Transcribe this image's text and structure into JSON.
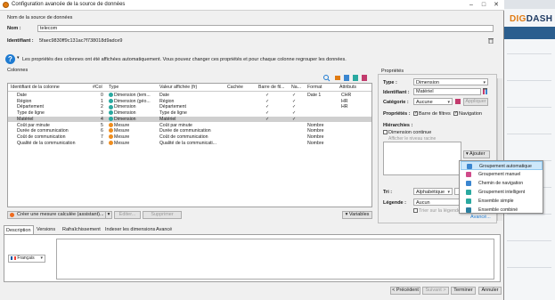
{
  "window": {
    "title": "Configuration avancée de la source de données"
  },
  "source": {
    "section_label": "Nom de la source de données",
    "name_label": "Nom :",
    "name_value": "telecom",
    "id_label": "Identifiant :",
    "id_value": "5faec9830ff9c131ac7f738018d9adce9"
  },
  "info_text": "Les propriétés des colonnes ont été affichées automatiquement. Vous pouvez changer ces propriétés et pour chaque colonne regrouper les données.",
  "columns_title": "Colonnes",
  "table": {
    "headers": [
      "Identifiant de la colonne",
      "#Col",
      "Type",
      "Valeur affichée (fr)",
      "Cachée",
      "Barre de fil...",
      "Na...",
      "Format",
      "Attributs"
    ],
    "rows": [
      {
        "id": "Date",
        "col": "0",
        "type": "Dimension (tem...",
        "kind": "dim",
        "value": "Date",
        "filter": "✓",
        "nav": "✓",
        "format": "Date 1",
        "attr": "CHR"
      },
      {
        "id": "Région",
        "col": "1",
        "type": "Dimension (géo...",
        "kind": "dim",
        "value": "Région",
        "filter": "✓",
        "nav": "✓",
        "format": "",
        "attr": "HR"
      },
      {
        "id": "Département",
        "col": "2",
        "type": "Dimension",
        "kind": "dim",
        "value": "Département",
        "filter": "✓",
        "nav": "✓",
        "format": "",
        "attr": "HR"
      },
      {
        "id": "Type de ligne",
        "col": "3",
        "type": "Dimension",
        "kind": "dim",
        "value": "Type de ligne",
        "filter": "✓",
        "nav": "✓",
        "format": "",
        "attr": ""
      },
      {
        "id": "Matériel",
        "col": "4",
        "type": "Dimension",
        "kind": "dim",
        "value": "Matériel",
        "filter": "✓",
        "nav": "✓",
        "format": "",
        "attr": ""
      },
      {
        "id": "Coût par minute",
        "col": "5",
        "type": "Mesure",
        "kind": "mes",
        "value": "Coût par minute",
        "filter": "",
        "nav": "",
        "format": "Nombre",
        "attr": ""
      },
      {
        "id": "Durée de communication",
        "col": "6",
        "type": "Mesure",
        "kind": "mes",
        "value": "Durée de communication",
        "filter": "",
        "nav": "",
        "format": "Nombre",
        "attr": ""
      },
      {
        "id": "Coût de communication",
        "col": "7",
        "type": "Mesure",
        "kind": "mes",
        "value": "Coût de communication",
        "filter": "",
        "nav": "",
        "format": "Nombre",
        "attr": ""
      },
      {
        "id": "Qualité de la communication",
        "col": "8",
        "type": "Mesure",
        "kind": "mes",
        "value": "Qualité de la communicati...",
        "filter": "",
        "nav": "",
        "format": "Nombre",
        "attr": ""
      }
    ],
    "selected_index": 4
  },
  "table_buttons": {
    "create_measure": "Créer une mesure calculée (assistant)...",
    "edit": "Éditer...",
    "delete": "Supprimer",
    "variables": "Variables"
  },
  "props": {
    "title": "Propriétés",
    "type_label": "Type :",
    "type_value": "Dimension",
    "id_label": "Identifiant :",
    "id_value": "Matériel",
    "category_label": "Catégorie :",
    "category_value": "Aucune",
    "apply": "Appliquer",
    "properties_label": "Propriétés :",
    "filter_bar": "Barre de filtres",
    "navigation": "Navigation",
    "hierarchies_label": "Hiérarchies :",
    "continuous": "Dimension continue",
    "show_level": "Afficher le niveau racine",
    "add_button": "Ajouter",
    "sort_label": "Tri :",
    "sort_value": "Alphabétique",
    "legend_label": "Légende :",
    "legend_value": "Aucun",
    "legend_sort": "Trier sur la légende",
    "advanced": "Avancé..."
  },
  "menu": [
    {
      "label": "Groupement automatique",
      "icon": "auto-group-icon",
      "color": "#3a86d0"
    },
    {
      "label": "Groupement manuel",
      "icon": "manual-group-icon",
      "color": "#d04a8a"
    },
    {
      "label": "Chemin de navigation",
      "icon": "nav-path-icon",
      "color": "#3a86d0"
    },
    {
      "label": "Groupement intelligent",
      "icon": "smart-group-icon",
      "color": "#2aa9a0"
    },
    {
      "label": "Ensemble simple",
      "icon": "simple-set-icon",
      "color": "#2aa9a0"
    },
    {
      "label": "Ensemble combiné",
      "icon": "combined-set-icon",
      "color": "#2a7fa0"
    }
  ],
  "tabs": [
    "Description",
    "Versions",
    "Rafraîchissement",
    "Indexer les dimensions",
    "Avancé"
  ],
  "language": "Français",
  "footer": {
    "prev": "< Précédent",
    "next": "Suivant >",
    "finish": "Terminer",
    "cancel": "Annuler"
  },
  "background_app": {
    "logo_left": "DIG",
    "logo_right": "DASH"
  }
}
